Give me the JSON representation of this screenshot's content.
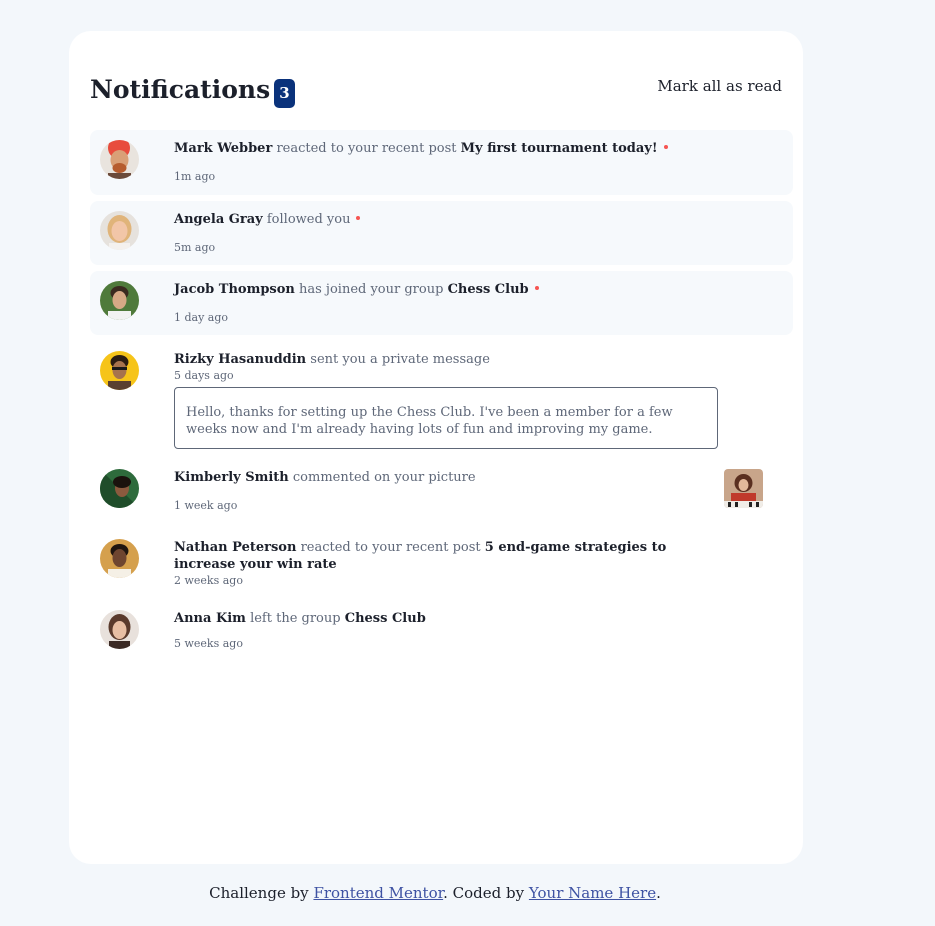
{
  "header": {
    "title": "Notifications",
    "unread_count": "3",
    "mark_all_label": "Mark all as read"
  },
  "notifications": [
    {
      "name": "Mark Webber",
      "action": "reacted to your recent post",
      "target": "My first tournament today!",
      "time": "1m ago",
      "unread": true
    },
    {
      "name": "Angela Gray",
      "action": "followed you",
      "time": "5m ago",
      "unread": true
    },
    {
      "name": "Jacob Thompson",
      "action": "has joined your group",
      "target": "Chess Club",
      "time": "1 day ago",
      "unread": true
    },
    {
      "name": "Rizky Hasanuddin",
      "action": "sent you a private message",
      "time": "5 days ago",
      "message": "Hello, thanks for setting up the Chess Club. I've been a member for a few weeks now and I'm already having lots of fun and improving my game.",
      "unread": false
    },
    {
      "name": "Kimberly Smith",
      "action": "commented on your picture",
      "time": "1 week ago",
      "unread": false
    },
    {
      "name": "Nathan Peterson",
      "action": "reacted to your recent post",
      "target": "5 end-game strategies to increase your win rate",
      "time": "2 weeks ago",
      "unread": false
    },
    {
      "name": "Anna Kim",
      "action": "left the group",
      "target": "Chess Club",
      "time": "5 weeks ago",
      "unread": false
    }
  ],
  "footer": {
    "prefix": "Challenge by",
    "link1": "Frontend Mentor",
    "middle": ". Coded by",
    "link2": "Your Name Here",
    "suffix": "."
  },
  "colors": {
    "page_bg": "#f3f7fb",
    "card_bg": "#ffffff",
    "unread_bg": "#f6f9fc",
    "badge_bg": "#0a327b",
    "dot": "#f65552",
    "text_dark": "#1c202b",
    "text_muted": "#5e6778",
    "link": "#3e52a3"
  }
}
